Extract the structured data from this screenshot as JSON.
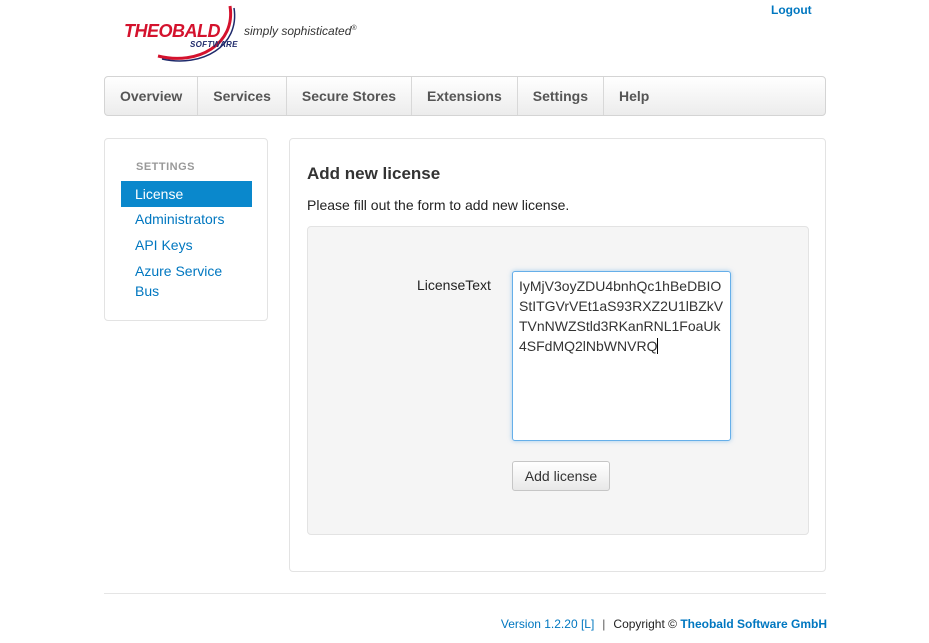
{
  "header": {
    "logo_word": "THEOBALD",
    "logo_sub": "SOFTWARE",
    "tagline": "simply sophisticated",
    "tagline_mark": "®",
    "logout": "Logout"
  },
  "nav": {
    "items": [
      "Overview",
      "Services",
      "Secure Stores",
      "Extensions",
      "Settings",
      "Help"
    ]
  },
  "sidebar": {
    "header": "SETTINGS",
    "items": [
      {
        "label": "License",
        "active": true
      },
      {
        "label": "Administrators",
        "active": false
      },
      {
        "label": "API Keys",
        "active": false
      },
      {
        "label": "Azure Service Bus",
        "active": false
      }
    ]
  },
  "main": {
    "title": "Add new license",
    "description": "Please fill out the form to add new license.",
    "field_label": "LicenseText",
    "license_value": "IyMjV3oyZDU4bnhQc1hBeDBIOStITGVrVEt1aS93RXZ2U1lBZkVTVnNWZStld3RKanRNL1FoaUk4SFdMQ2lNbWNVRQ",
    "submit_label": "Add license"
  },
  "footer": {
    "version": "Version 1.2.20 [L]",
    "separator": "|",
    "copyright": "Copyright ©",
    "company": "Theobald Software GmbH"
  },
  "colors": {
    "link": "#0077c0",
    "active_nav": "#0a88cc",
    "brand_red": "#d4122d",
    "brand_navy": "#1f2a6b"
  }
}
